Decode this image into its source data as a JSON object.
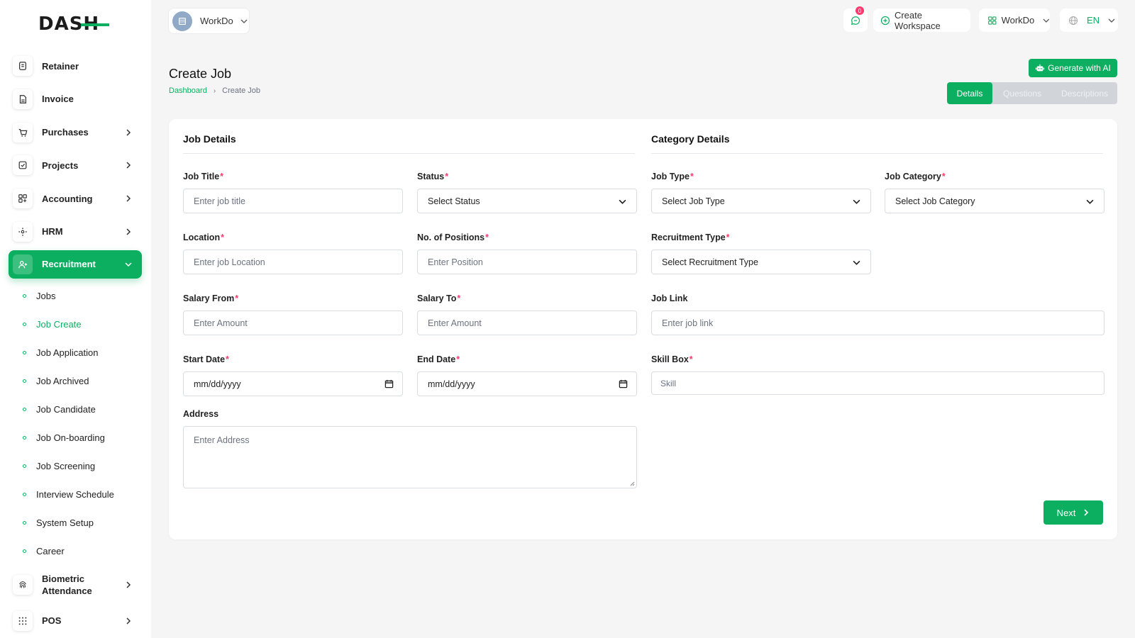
{
  "brand": {
    "logo_text": "DASH",
    "accent_color": "#0caf60"
  },
  "sidebar": {
    "items": [
      {
        "label": "Retainer",
        "icon": "receipt-icon",
        "has_children": false
      },
      {
        "label": "Invoice",
        "icon": "file-icon",
        "has_children": false
      },
      {
        "label": "Purchases",
        "icon": "cart-icon",
        "has_children": true
      },
      {
        "label": "Projects",
        "icon": "checkbox-icon",
        "has_children": true
      },
      {
        "label": "Accounting",
        "icon": "grid-icon",
        "has_children": true
      },
      {
        "label": "HRM",
        "icon": "hrm-icon",
        "has_children": true
      },
      {
        "label": "Recruitment",
        "icon": "user-plus-icon",
        "has_children": true,
        "active": true
      }
    ],
    "sub_items": [
      {
        "label": "Jobs"
      },
      {
        "label": "Job Create",
        "active": true
      },
      {
        "label": "Job Application"
      },
      {
        "label": "Job Archived"
      },
      {
        "label": "Job Candidate"
      },
      {
        "label": "Job On-boarding"
      },
      {
        "label": "Job Screening"
      },
      {
        "label": "Interview Schedule"
      },
      {
        "label": "System Setup"
      },
      {
        "label": "Career"
      }
    ],
    "bottom_items": [
      {
        "label": "Biometric Attendance",
        "icon": "fingerprint-icon"
      },
      {
        "label": "POS",
        "icon": "dots-grid-icon"
      }
    ]
  },
  "topbar": {
    "workspace": "WorkDo",
    "notification_count": "0",
    "create_workspace": "Create Workspace",
    "workdo_menu": "WorkDo",
    "language": "EN"
  },
  "page": {
    "title": "Create Job",
    "breadcrumb": [
      "Dashboard",
      "Create Job"
    ],
    "generate_ai": "Generate with AI",
    "tabs": [
      "Details",
      "Questions",
      "Descriptions"
    ],
    "active_tab": "Details"
  },
  "form": {
    "job_details_title": "Job Details",
    "category_details_title": "Category Details",
    "job_title": {
      "label": "Job Title",
      "placeholder": "Enter job title",
      "required": "*"
    },
    "status": {
      "label": "Status",
      "value": "Select Status",
      "required": "*"
    },
    "job_type": {
      "label": "Job Type",
      "value": "Select Job Type",
      "required": "*"
    },
    "job_category": {
      "label": "Job Category",
      "value": "Select Job Category",
      "required": "*"
    },
    "location": {
      "label": "Location",
      "placeholder": "Enter job Location",
      "required": "*"
    },
    "positions": {
      "label": "No. of Positions",
      "placeholder": "Enter Position",
      "required": "*"
    },
    "recruitment_type": {
      "label": "Recruitment Type",
      "value": "Select Recruitment Type",
      "required": "*"
    },
    "salary_from": {
      "label": "Salary From",
      "placeholder": "Enter Amount",
      "required": "*"
    },
    "salary_to": {
      "label": "Salary To",
      "placeholder": "Enter Amount",
      "required": "*"
    },
    "job_link": {
      "label": "Job Link",
      "placeholder": "Enter job link"
    },
    "start_date": {
      "label": "Start Date",
      "value": "mm/dd/yyyy",
      "required": "*"
    },
    "end_date": {
      "label": "End Date",
      "value": "mm/dd/yyyy",
      "required": "*"
    },
    "skill_box": {
      "label": "Skill Box",
      "placeholder": "Skill",
      "required": "*"
    },
    "address": {
      "label": "Address",
      "placeholder": "Enter Address"
    },
    "next_button": "Next"
  }
}
